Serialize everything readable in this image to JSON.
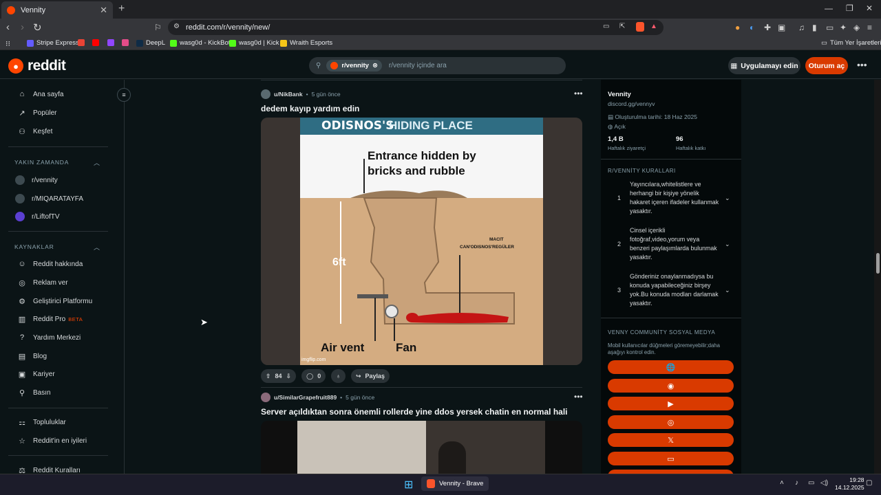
{
  "browser": {
    "tab_title": "Vennity",
    "tab_close": "✕",
    "new_tab": "+",
    "url": "reddit.com/r/vennity/new/",
    "window_controls": [
      "—",
      "❐",
      "✕"
    ],
    "bookmarks": [
      {
        "label": "Stripe Express",
        "color": "#635bff"
      },
      {
        "label": "",
        "color": "#ea4335"
      },
      {
        "label": "",
        "color": "#ff0000"
      },
      {
        "label": "",
        "color": "#9146ff"
      },
      {
        "label": "",
        "color": "#e44c89"
      },
      {
        "label": "DeepL",
        "color": "#0f2b46"
      },
      {
        "label": "wasg0d - KickBot",
        "color": "#53fc18"
      },
      {
        "label": "wasg0d | Kick",
        "color": "#53fc18"
      },
      {
        "label": "Wraith Esports",
        "color": "#f5c518"
      }
    ],
    "other_bookmarks": "Tüm Yer İşaretleri"
  },
  "header": {
    "logo": "reddit",
    "search_chip": "r/vennity",
    "search_placeholder": "r/vennity içinde ara",
    "app_button": "Uygulamayı edin",
    "login_button": "Oturum aç",
    "more": "•••"
  },
  "left_nav": {
    "main": [
      {
        "label": "Ana sayfa",
        "icon": "home-icon",
        "glyph": "⌂"
      },
      {
        "label": "Popüler",
        "icon": "popular-icon",
        "glyph": "↗"
      },
      {
        "label": "Keşfet",
        "icon": "explore-icon",
        "glyph": "⚇"
      }
    ],
    "recent_title": "YAKIN ZAMANDA",
    "recent": [
      {
        "label": "r/vennity"
      },
      {
        "label": "r/MIQARATAYFA"
      },
      {
        "label": "r/LiftofTV"
      }
    ],
    "resources_title": "KAYNAKLAR",
    "resources": [
      {
        "label": "Reddit hakkında",
        "icon": "reddit-about-icon",
        "glyph": "☺"
      },
      {
        "label": "Reklam ver",
        "icon": "advertise-icon",
        "glyph": "◎"
      },
      {
        "label": "Geliştirici Platformu",
        "icon": "developer-icon",
        "glyph": "⚙"
      },
      {
        "label": "Reddit Pro",
        "icon": "pro-icon",
        "glyph": "▥",
        "badge": "BETA"
      },
      {
        "label": "Yardım Merkezi",
        "icon": "help-icon",
        "glyph": "?"
      },
      {
        "label": "Blog",
        "icon": "blog-icon",
        "glyph": "▤"
      },
      {
        "label": "Kariyer",
        "icon": "careers-icon",
        "glyph": "▣"
      },
      {
        "label": "Basın",
        "icon": "press-icon",
        "glyph": "⚲"
      }
    ],
    "more": [
      {
        "label": "Topluluklar",
        "icon": "communities-icon",
        "glyph": "⚏"
      },
      {
        "label": "Reddit'in en iyileri",
        "icon": "best-of-icon",
        "glyph": "☆"
      }
    ],
    "rules_link": {
      "label": "Reddit Kuralları",
      "icon": "rules-icon",
      "glyph": "⚖"
    }
  },
  "posts": [
    {
      "user": "u/NikBank",
      "time": "5 gün önce",
      "title": "dedem kayıp yardım edin",
      "image": {
        "header_left": "ODISNOS'S",
        "header_right": "HIDING PLACE",
        "entrance": "Entrance hidden by bricks and rubble",
        "depth": "6ft",
        "macit": "MACIT",
        "label2": "CAN'ODISNOS'REGÜLER",
        "air_vent": "Air vent",
        "fan": "Fan",
        "watermark": "imgflip.com"
      },
      "votes": "84",
      "comments": "0",
      "share": "Paylaş"
    },
    {
      "user": "u/SimilarGrapefruit889",
      "time": "5 gün önce",
      "title": "Server açıldıktan sonra önemli rollerde yine ddos yersek chatin en normal hali"
    }
  ],
  "community": {
    "name": "Vennity",
    "link": "discord.gg/vennyv",
    "created": "Oluşturulma tarihi: 18 Haz 2025",
    "visibility": "Açık",
    "weekly_visitors_value": "1,4 B",
    "weekly_visitors_label": "Haftalık ziyaretçi",
    "weekly_contrib_value": "96",
    "weekly_contrib_label": "Haftalık katkı",
    "rules_title": "R/VENNİTY KURALLARI",
    "rules": [
      {
        "num": "1",
        "text": "Yayıncılara,whitelistlere ve herhangi bir kişiye yönelik hakaret içeren ifadeler kullanmak yasaktır."
      },
      {
        "num": "2",
        "text": "Cinsel içerikli fotoğraf,video,yorum veya benzeri paylaşımlarda bulunmak yasaktır."
      },
      {
        "num": "3",
        "text": "Gönderiniz onaylanmadıysa bu konuda yapabileceğiniz birşey yok.Bu konuda modları darlamak yasaktır."
      }
    ],
    "social_title": "VENNY COMMUNİTY SOSYAL MEDYA",
    "social_note": "Mobil kullanıcılar düğmeleri göremeyebilir;daha aşağıyı kontrol edin.",
    "social_buttons": [
      {
        "icon": "globe-icon",
        "glyph": "🌐"
      },
      {
        "icon": "discord-icon",
        "glyph": "◉"
      },
      {
        "icon": "youtube-icon",
        "glyph": "▶"
      },
      {
        "icon": "instagram-icon",
        "glyph": "◎"
      },
      {
        "icon": "x-icon",
        "glyph": "𝕏"
      },
      {
        "icon": "twitch-icon",
        "glyph": "▭"
      }
    ]
  },
  "taskbar": {
    "app": "Vennity - Brave",
    "time": "19:28",
    "date": "14.12.2025"
  }
}
